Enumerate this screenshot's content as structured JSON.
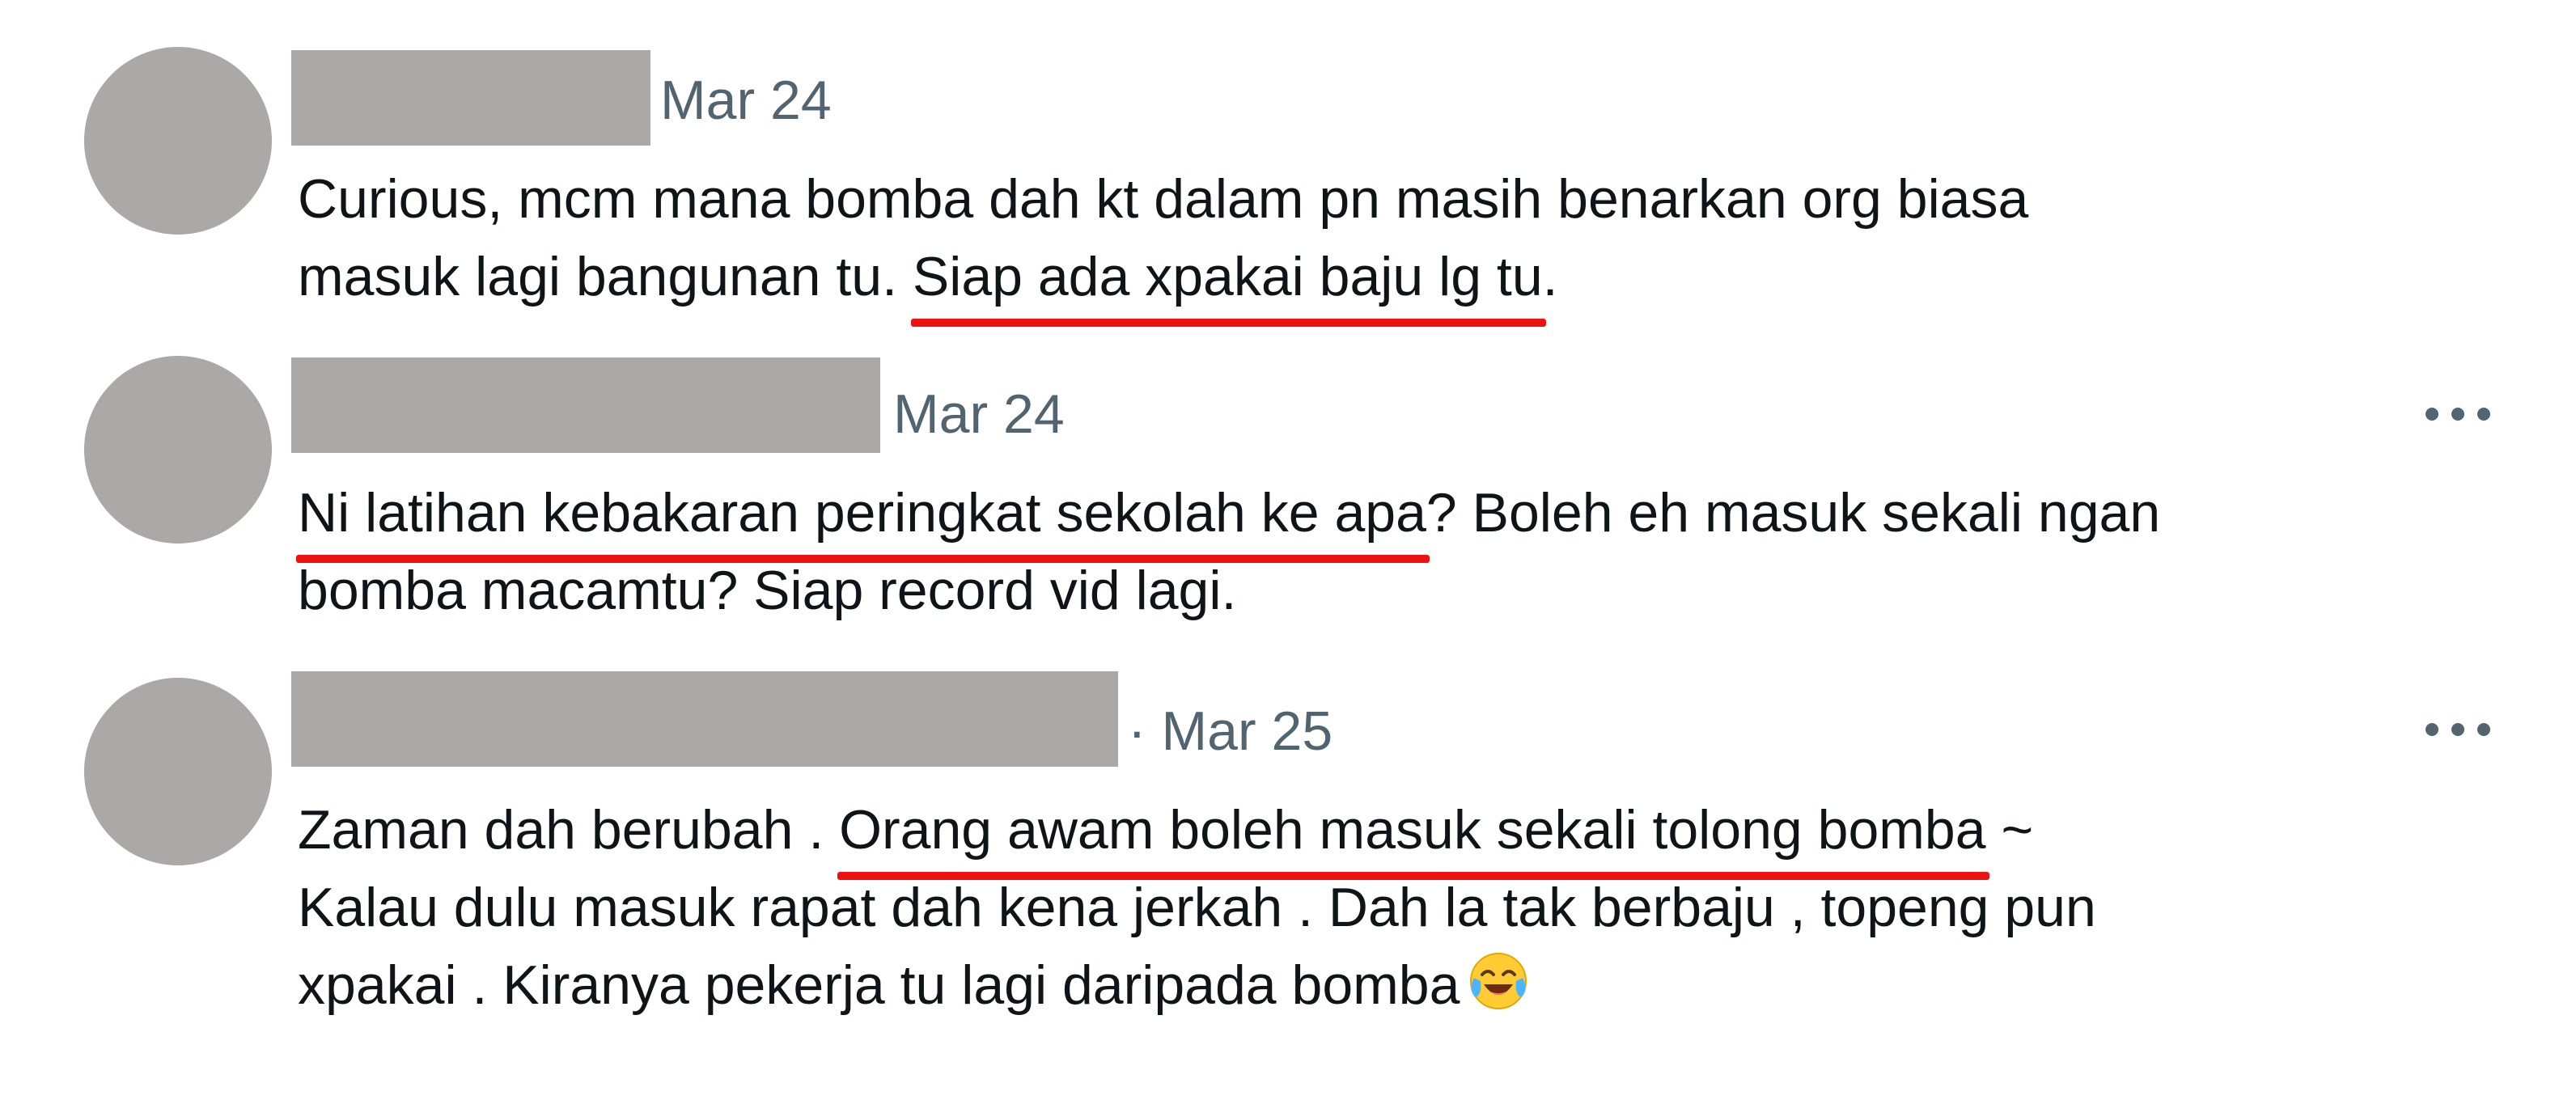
{
  "tweets": [
    {
      "date": "Mar 24",
      "line1": "Curious, mcm mana bomba dah kt dalam pn masih benarkan org biasa",
      "line2_before": "masuk lagi bangunan tu. ",
      "line2_underlined": "Siap ada xpakai baju lg tu",
      "line2_after": "."
    },
    {
      "date": "Mar 24",
      "line1_underlined": "Ni latihan kebakaran peringkat sekolah ke apa",
      "line1_after": "? Boleh eh masuk sekali ngan",
      "line2": "bomba macamtu? Siap record vid lagi."
    },
    {
      "date": "· Mar 25",
      "line1_before": "Zaman dah berubah . ",
      "line1_underlined": "Orang awam boleh masuk sekali tolong bomba",
      "line1_after": " ~",
      "line2": "Kalau dulu masuk rapat dah kena jerkah . Dah la tak berbaju , topeng pun",
      "line3": "xpakai . Kiranya pekerja tu lagi daripada bomba",
      "emoji": "face-with-tears-of-joy-icon"
    }
  ],
  "colors": {
    "redaction": "#ada8a8",
    "date": "#536471",
    "text": "#0f1419",
    "underline": "#ee1111"
  }
}
